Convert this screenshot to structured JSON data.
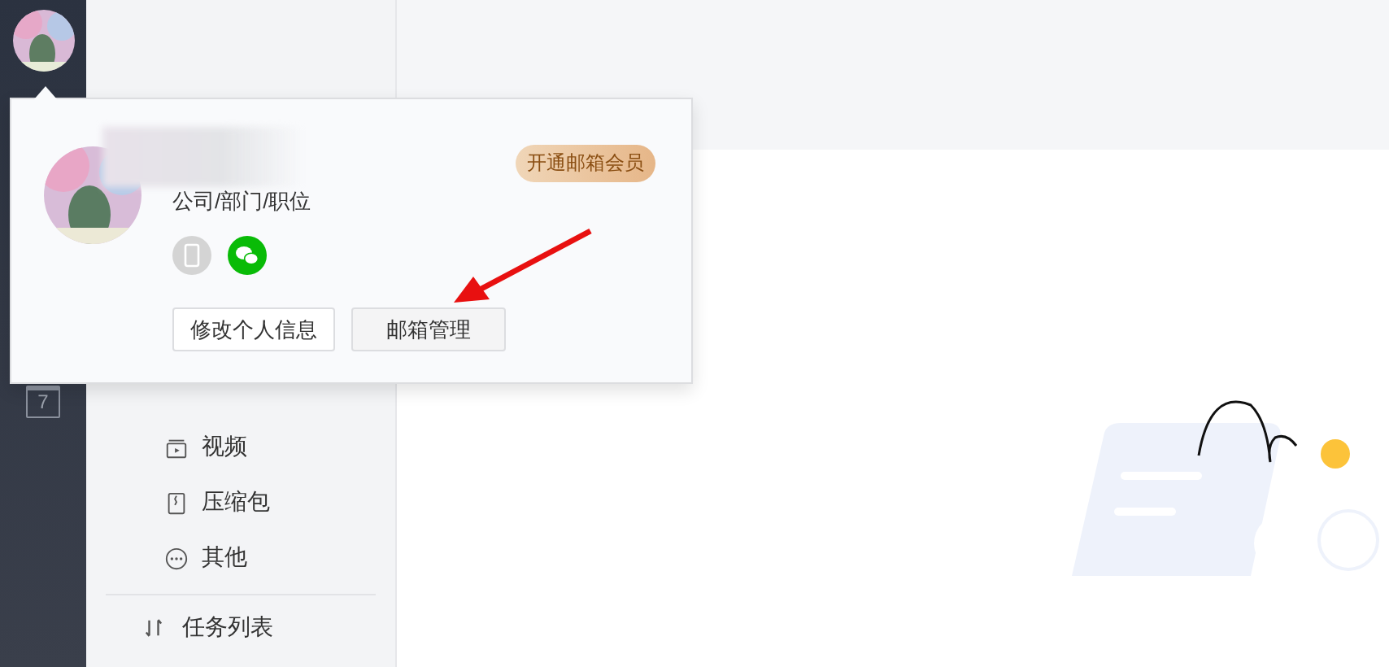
{
  "sidebar": {
    "calendar_day": "7"
  },
  "nav": {
    "items": [
      {
        "kind": "video",
        "label": "视频"
      },
      {
        "kind": "zip",
        "label": "压缩包"
      },
      {
        "kind": "other",
        "label": "其他"
      }
    ],
    "task_list": "任务列表"
  },
  "profile_popup": {
    "company": "公司/部门/职位",
    "member_badge": "开通邮箱会员",
    "buttons": [
      {
        "label": "修改个人信息",
        "highlighted": false
      },
      {
        "label": "邮箱管理",
        "highlighted": true
      }
    ]
  }
}
